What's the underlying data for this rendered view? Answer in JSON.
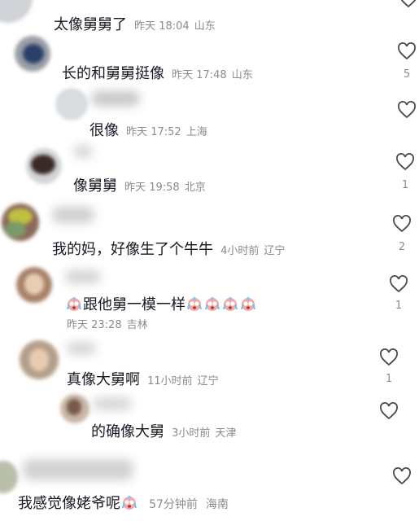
{
  "comments": [
    {
      "text": "太像舅舅了",
      "time": "昨天 18:04",
      "location": "山东",
      "likes": ""
    },
    {
      "text": "长的和舅舅挺像",
      "time": "昨天 17:48",
      "location": "山东",
      "likes": "5"
    },
    {
      "text": "很像",
      "time": "昨天 17:52",
      "location": "上海",
      "likes": ""
    },
    {
      "text": "像舅舅",
      "time": "昨天 19:58",
      "location": "北京",
      "likes": "1"
    },
    {
      "text": "我的妈，好像生了个牛牛",
      "time": "4小时前",
      "location": "辽宁",
      "likes": "2"
    },
    {
      "text": "跟他舅一模一样",
      "time": "昨天 23:28",
      "location": "吉林",
      "likes": "1"
    },
    {
      "text": "真像大舅啊",
      "time": "11小时前",
      "location": "辽宁",
      "likes": "1"
    },
    {
      "text": "的确像大舅",
      "time": "3小时前",
      "location": "天津",
      "likes": ""
    },
    {
      "text": "我感觉像姥爷呢",
      "time": "57分钟前",
      "location": "海南",
      "likes": ""
    }
  ],
  "icons": {
    "like": "heart-outline-icon",
    "emoji": "crying-face-emoji"
  },
  "colors": {
    "text": "#161823",
    "meta": "#8a8b91",
    "heart": "#4a4a4a"
  }
}
